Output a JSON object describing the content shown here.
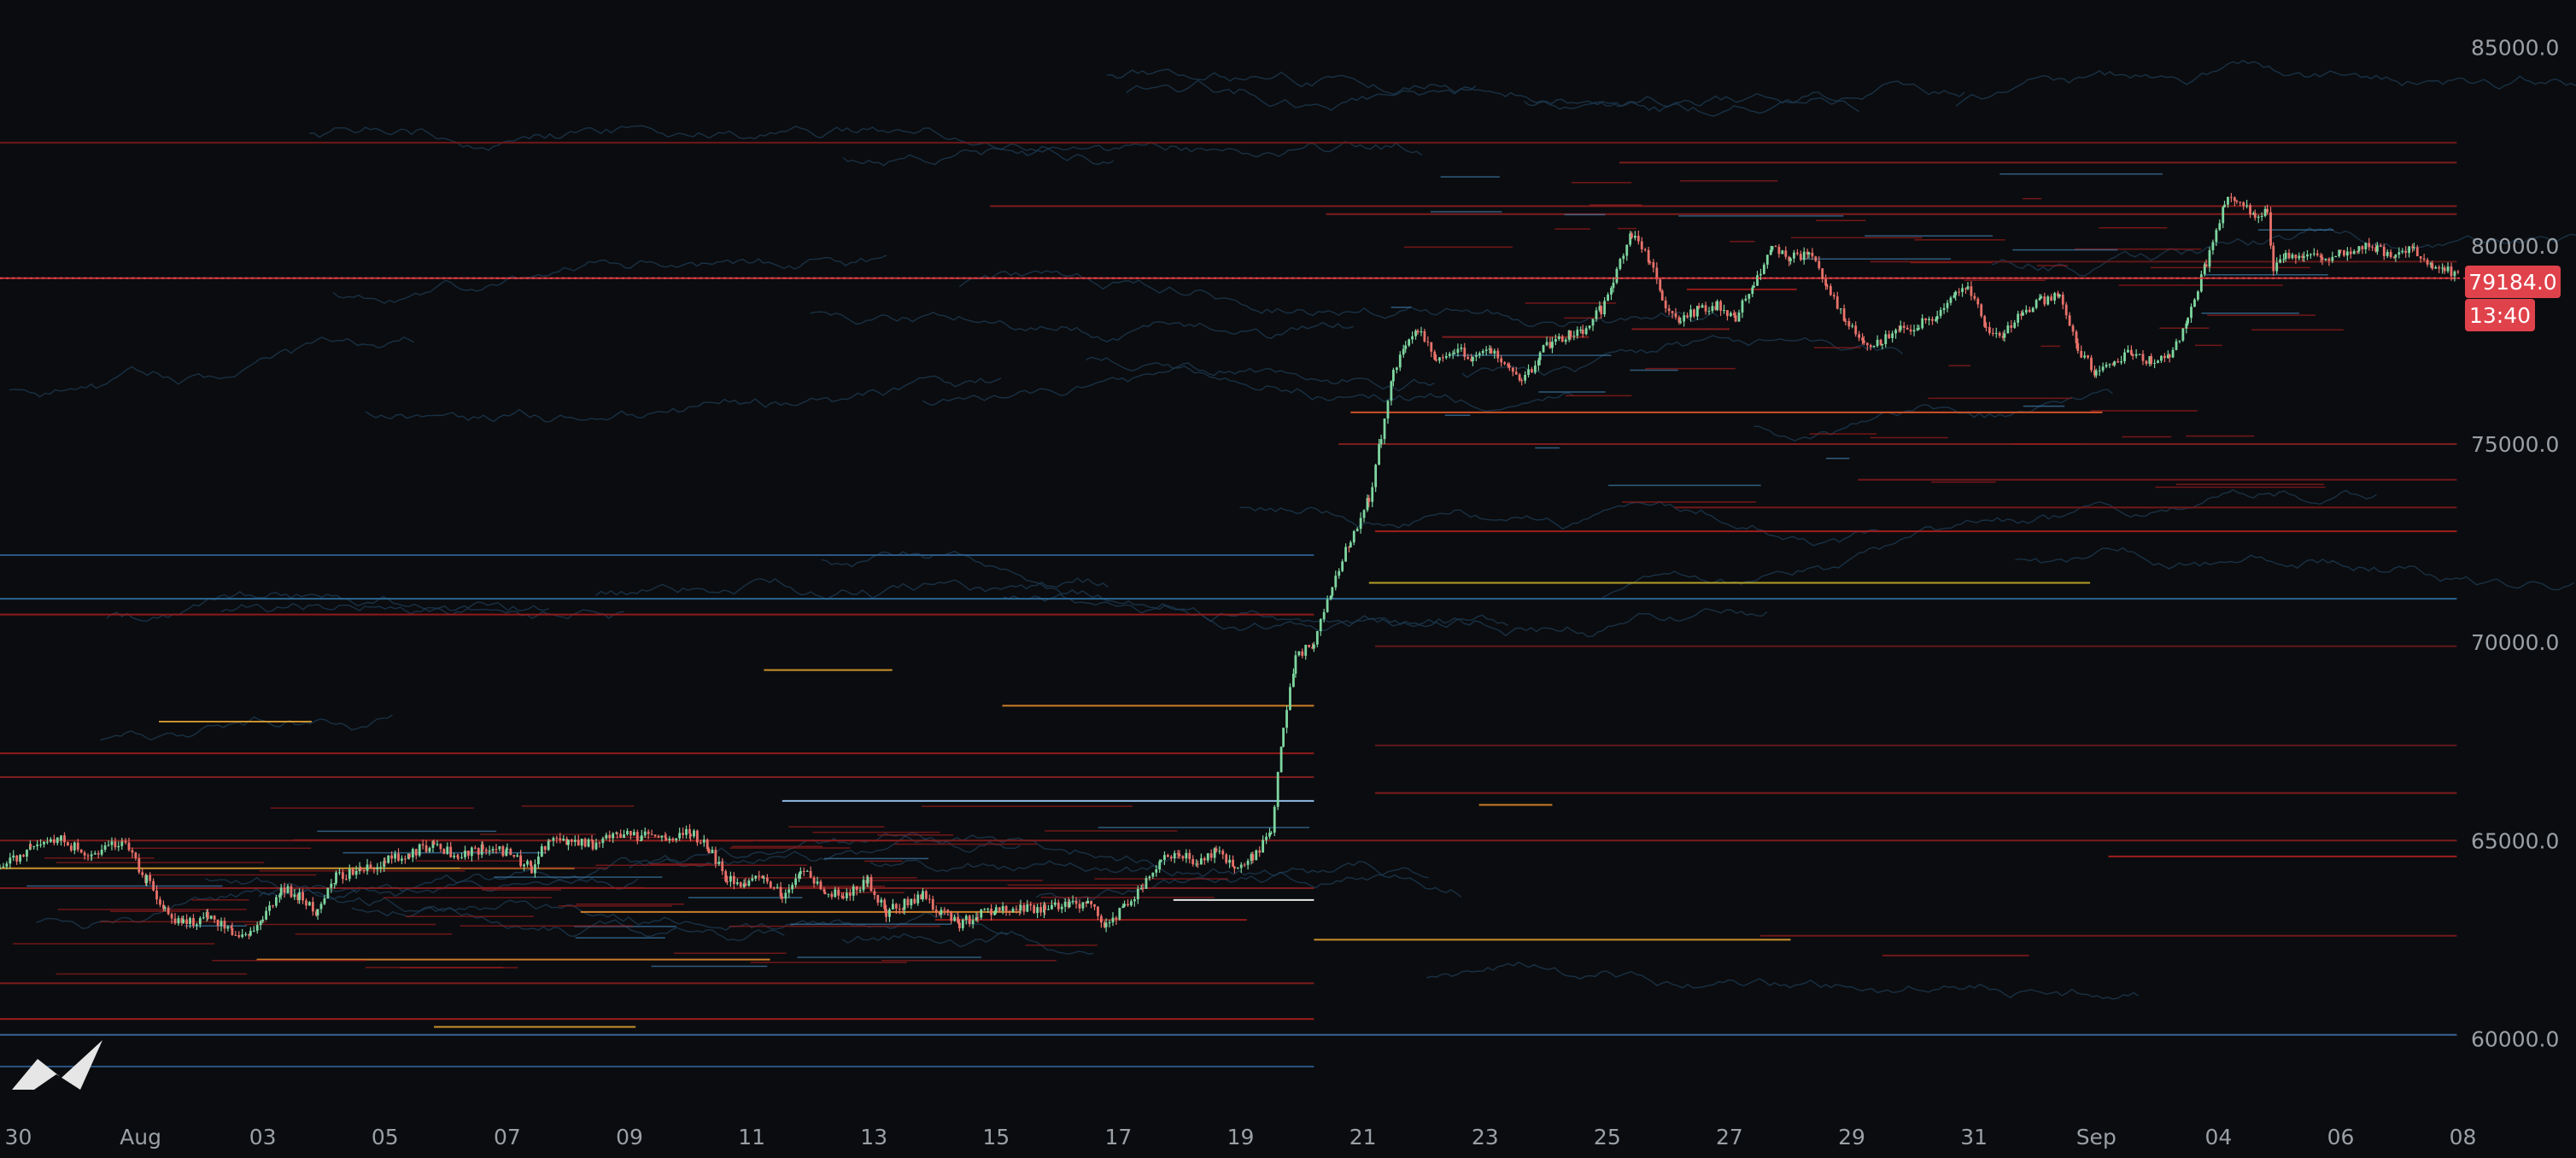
{
  "chart_data": {
    "type": "line",
    "title": "",
    "xlabel": "",
    "ylabel": "",
    "x_tick_labels": [
      "30",
      "Aug",
      "03",
      "05",
      "07",
      "09",
      "11",
      "13",
      "15",
      "17",
      "19",
      "21",
      "23",
      "25",
      "27",
      "29",
      "31",
      "Sep",
      "04",
      "06",
      "08"
    ],
    "x_domain_days": [
      -1.3,
      38.95
    ],
    "y_ticks": [
      "85000.0",
      "80000.0",
      "75000.0",
      "70000.0",
      "65000.0",
      "60000.0"
    ],
    "ylim": [
      58200,
      86200
    ],
    "grid": false,
    "last_price": "79184.0",
    "countdown": "13:40",
    "last_price_value": 79184,
    "series": [
      {
        "type": "candlestick",
        "points": [
          [
            -1.3,
            64300
          ],
          [
            -0.8,
            64800
          ],
          [
            -0.3,
            65000
          ],
          [
            0.2,
            64600
          ],
          [
            0.7,
            65000
          ],
          [
            1.1,
            64000
          ],
          [
            1.4,
            63200
          ],
          [
            1.7,
            62900
          ],
          [
            2.1,
            63100
          ],
          [
            2.5,
            62700
          ],
          [
            2.8,
            62600
          ],
          [
            3.0,
            63000
          ],
          [
            3.3,
            63800
          ],
          [
            3.6,
            63600
          ],
          [
            3.9,
            63200
          ],
          [
            4.2,
            64100
          ],
          [
            4.6,
            64200
          ],
          [
            5.0,
            64500
          ],
          [
            5.4,
            64700
          ],
          [
            5.8,
            64900
          ],
          [
            6.2,
            64600
          ],
          [
            6.6,
            64800
          ],
          [
            7.0,
            64700
          ],
          [
            7.4,
            64300
          ],
          [
            7.7,
            65100
          ],
          [
            8.0,
            65000
          ],
          [
            8.4,
            64900
          ],
          [
            8.8,
            65200
          ],
          [
            9.2,
            65100
          ],
          [
            9.6,
            65100
          ],
          [
            10.0,
            65200
          ],
          [
            10.3,
            64800
          ],
          [
            10.6,
            64000
          ],
          [
            10.9,
            63900
          ],
          [
            11.2,
            64100
          ],
          [
            11.5,
            63600
          ],
          [
            11.8,
            64300
          ],
          [
            12.2,
            63700
          ],
          [
            12.5,
            63600
          ],
          [
            12.9,
            64000
          ],
          [
            13.2,
            63200
          ],
          [
            13.5,
            63400
          ],
          [
            13.8,
            63600
          ],
          [
            14.1,
            63200
          ],
          [
            14.4,
            62900
          ],
          [
            14.7,
            63100
          ],
          [
            15.0,
            63300
          ],
          [
            15.4,
            63300
          ],
          [
            15.8,
            63300
          ],
          [
            16.2,
            63400
          ],
          [
            16.5,
            63400
          ],
          [
            16.8,
            62900
          ],
          [
            17.1,
            63300
          ],
          [
            17.4,
            63900
          ],
          [
            17.7,
            64500
          ],
          [
            18.0,
            64600
          ],
          [
            18.3,
            64500
          ],
          [
            18.6,
            64700
          ],
          [
            18.9,
            64400
          ],
          [
            19.2,
            64600
          ],
          [
            19.5,
            65200
          ],
          [
            19.7,
            67800
          ],
          [
            19.9,
            69600
          ],
          [
            20.2,
            70000
          ],
          [
            20.5,
            71400
          ],
          [
            20.8,
            72600
          ],
          [
            21.1,
            73600
          ],
          [
            21.3,
            75200
          ],
          [
            21.5,
            76800
          ],
          [
            21.7,
            77500
          ],
          [
            21.9,
            77900
          ],
          [
            22.2,
            77100
          ],
          [
            22.5,
            77400
          ],
          [
            22.8,
            77200
          ],
          [
            23.1,
            77300
          ],
          [
            23.4,
            77000
          ],
          [
            23.6,
            76500
          ],
          [
            23.9,
            77300
          ],
          [
            24.1,
            77600
          ],
          [
            24.4,
            77800
          ],
          [
            24.6,
            77900
          ],
          [
            24.9,
            78400
          ],
          [
            25.1,
            79200
          ],
          [
            25.4,
            80300
          ],
          [
            25.7,
            79600
          ],
          [
            25.9,
            78600
          ],
          [
            26.2,
            78100
          ],
          [
            26.5,
            78400
          ],
          [
            26.8,
            78500
          ],
          [
            27.1,
            78200
          ],
          [
            27.4,
            79100
          ],
          [
            27.7,
            79900
          ],
          [
            28.0,
            79700
          ],
          [
            28.3,
            79800
          ],
          [
            28.6,
            79000
          ],
          [
            28.9,
            78100
          ],
          [
            29.2,
            77500
          ],
          [
            29.5,
            77600
          ],
          [
            29.8,
            77900
          ],
          [
            30.1,
            78000
          ],
          [
            30.4,
            78300
          ],
          [
            30.7,
            78800
          ],
          [
            30.9,
            79000
          ],
          [
            31.2,
            77900
          ],
          [
            31.5,
            77800
          ],
          [
            31.8,
            78300
          ],
          [
            32.1,
            78600
          ],
          [
            32.4,
            78800
          ],
          [
            32.7,
            77400
          ],
          [
            33.0,
            76800
          ],
          [
            33.3,
            77100
          ],
          [
            33.6,
            77300
          ],
          [
            33.9,
            77100
          ],
          [
            34.2,
            77200
          ],
          [
            34.5,
            78100
          ],
          [
            34.8,
            79600
          ],
          [
            35.1,
            81100
          ],
          [
            35.3,
            81200
          ],
          [
            35.6,
            80800
          ],
          [
            35.8,
            80900
          ],
          [
            35.9,
            79400
          ],
          [
            36.1,
            79800
          ],
          [
            36.4,
            79800
          ],
          [
            36.7,
            79700
          ],
          [
            37.0,
            79800
          ],
          [
            37.3,
            80000
          ],
          [
            37.6,
            79900
          ],
          [
            37.9,
            79800
          ],
          [
            38.2,
            79900
          ],
          [
            38.5,
            79400
          ],
          [
            38.7,
            79400
          ],
          [
            38.95,
            79200
          ]
        ]
      },
      {
        "type": "liquidation-heatmap-levels",
        "levels": [
          [
            -1.3,
            38.9,
            79184,
            "#d23a3a"
          ],
          [
            -1.3,
            38.9,
            82600,
            "#7a1a1a"
          ],
          [
            25.2,
            38.9,
            82100,
            "#8a1f1f"
          ],
          [
            14.9,
            38.9,
            81000,
            "#8a1f1f"
          ],
          [
            20.4,
            38.9,
            80800,
            "#8a1f1f"
          ],
          [
            20.8,
            33.1,
            75800,
            "#e45a2a"
          ],
          [
            20.6,
            38.9,
            75000,
            "#8a1f1f"
          ],
          [
            21.2,
            38.9,
            72800,
            "#b02020"
          ],
          [
            21.1,
            32.9,
            71500,
            "#c8b02a"
          ],
          [
            -1.3,
            20.2,
            72200,
            "#2f5f8f"
          ],
          [
            -1.3,
            20.2,
            70700,
            "#a01c1c"
          ],
          [
            -1.3,
            38.9,
            71100,
            "#2f6f9f"
          ],
          [
            15.1,
            20.2,
            68400,
            "#e08a2a"
          ],
          [
            -1.3,
            20.2,
            67200,
            "#a01c1c"
          ],
          [
            -1.3,
            20.2,
            66600,
            "#8a1f1f"
          ],
          [
            11.5,
            20.2,
            66000,
            "#9fd0ff"
          ],
          [
            22.9,
            24.1,
            65900,
            "#e08a2a"
          ],
          [
            -1.3,
            38.9,
            65000,
            "#8a1f1f"
          ],
          [
            33.2,
            38.9,
            64600,
            "#b02020"
          ],
          [
            27.5,
            38.9,
            62600,
            "#7a1a1a"
          ],
          [
            20.2,
            28.0,
            62500,
            "#e0a030"
          ],
          [
            -1.3,
            20.2,
            61400,
            "#8a1f1f"
          ],
          [
            -1.3,
            20.2,
            60500,
            "#b02020"
          ],
          [
            -1.3,
            38.9,
            60100,
            "#3f6f9f"
          ],
          [
            8.2,
            15.4,
            63200,
            "#e08a2a"
          ],
          [
            2.9,
            11.3,
            62000,
            "#e08a2a"
          ],
          [
            -1.3,
            20.2,
            63800,
            "#8a1f1f"
          ],
          [
            29.5,
            31.9,
            62100,
            "#7a1a1a"
          ],
          [
            26.3,
            28.1,
            78900,
            "#a01c1c"
          ],
          [
            25.4,
            27.0,
            77900,
            "#8a1f1f"
          ],
          [
            29.1,
            38.9,
            74100,
            "#7a1a1a"
          ],
          [
            26.1,
            38.9,
            73400,
            "#7a1a1a"
          ],
          [
            21.2,
            38.9,
            69900,
            "#6a1a1a"
          ],
          [
            21.2,
            38.9,
            67400,
            "#6a1a1a"
          ],
          [
            21.2,
            38.9,
            66200,
            "#8a1f1f"
          ],
          [
            -1.3,
            8.1,
            64300,
            "#e0a030"
          ],
          [
            1.3,
            3.8,
            68000,
            "#e0a030"
          ],
          [
            5.8,
            9.1,
            60300,
            "#e0a030"
          ],
          [
            11.2,
            13.3,
            69300,
            "#e0a030"
          ],
          [
            -1.3,
            20.2,
            59300,
            "#2f5f8f"
          ],
          [
            29.3,
            38.9,
            79600,
            "#6a1a1a"
          ],
          [
            22.3,
            24.7,
            77700,
            "#8a1f1f"
          ],
          [
            17.9,
            20.2,
            63500,
            "#ffffff"
          ],
          [
            14.0,
            19.1,
            63000,
            "#a01c1c"
          ]
        ]
      }
    ]
  }
}
